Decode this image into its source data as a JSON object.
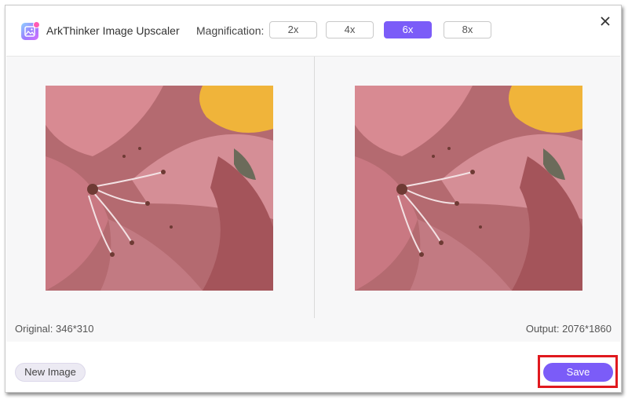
{
  "app": {
    "title": "ArkThinker Image Upscaler",
    "icon": "image-upscaler-icon",
    "accent_color": "#7b5cf8"
  },
  "magnification": {
    "label": "Magnification:",
    "options": [
      "2x",
      "4x",
      "6x",
      "8x"
    ],
    "selected": "6x"
  },
  "close": {
    "icon": "close-icon"
  },
  "preview": {
    "original_label": "Original: 346*310",
    "output_label": "Output: 2076*1860"
  },
  "actions": {
    "new_image_label": "New Image",
    "save_label": "Save",
    "save_highlight_color": "#e0191e"
  }
}
